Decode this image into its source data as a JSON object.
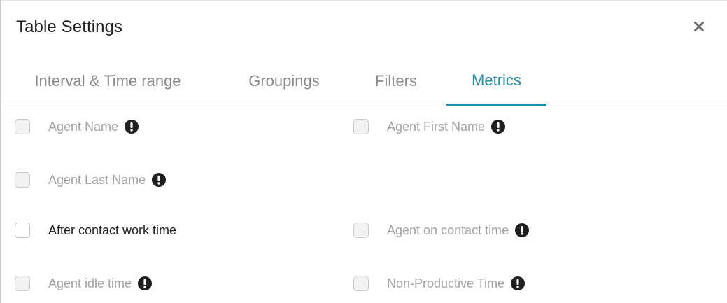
{
  "dialog": {
    "title": "Table Settings",
    "close_icon": "close-icon"
  },
  "tabs": [
    {
      "label": "Interval & Time range",
      "active": false
    },
    {
      "label": "Groupings",
      "active": false
    },
    {
      "label": "Filters",
      "active": false
    },
    {
      "label": "Metrics",
      "active": true
    }
  ],
  "colors": {
    "accent": "#1f8fb0",
    "disabled_text": "#a3a3a3",
    "enabled_text": "#222222"
  },
  "metrics": [
    {
      "label": "Agent Name",
      "enabled": false,
      "info_icon": true,
      "checked": false
    },
    {
      "label": "Agent First Name",
      "enabled": false,
      "info_icon": true,
      "checked": false
    },
    {
      "label": "Agent Last Name",
      "enabled": false,
      "info_icon": true,
      "checked": false
    },
    {
      "label": "After contact work time",
      "enabled": true,
      "info_icon": false,
      "checked": false
    },
    {
      "label": "Agent on contact time",
      "enabled": false,
      "info_icon": true,
      "checked": false
    },
    {
      "label": "Agent idle time",
      "enabled": false,
      "info_icon": true,
      "checked": false
    },
    {
      "label": "Non-Productive Time",
      "enabled": false,
      "info_icon": true,
      "checked": false
    }
  ]
}
